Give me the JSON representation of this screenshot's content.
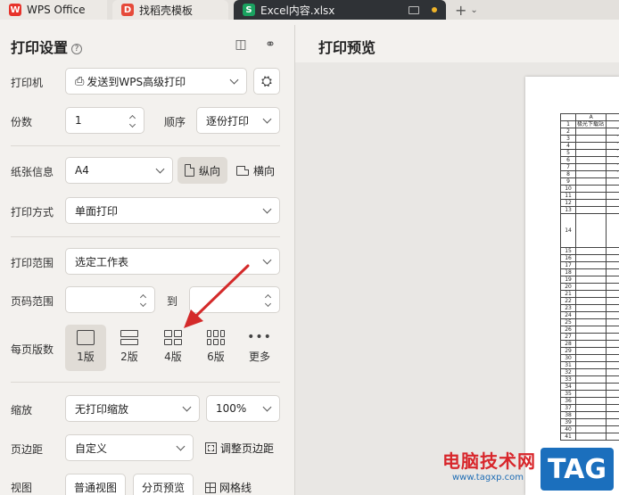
{
  "tabs": [
    {
      "label": "WPS Office",
      "icon": "wps-logo-icon"
    },
    {
      "label": "找稻壳模板",
      "icon": "daoke-logo-icon"
    },
    {
      "label": "Excel内容.xlsx",
      "icon": "excel-file-icon",
      "active": true
    }
  ],
  "panel": {
    "title": "打印设置",
    "printer": {
      "label": "打印机",
      "value": "发送到WPS高级打印"
    },
    "copies": {
      "label": "份数",
      "value": "1"
    },
    "order": {
      "label": "顺序",
      "value": "逐份打印"
    },
    "paper": {
      "label": "纸张信息",
      "size": "A4",
      "portrait": "纵向",
      "landscape": "横向"
    },
    "print_mode": {
      "label": "打印方式",
      "value": "单面打印"
    },
    "range": {
      "label": "打印范围",
      "value": "选定工作表"
    },
    "page_range": {
      "label": "页码范围",
      "to": "到"
    },
    "pages_per_sheet": {
      "label": "每页版数",
      "options": [
        "1版",
        "2版",
        "4版",
        "6版",
        "更多"
      ],
      "selected": "1版"
    },
    "scale": {
      "label": "缩放",
      "value": "无打印缩放",
      "percent": "100%"
    },
    "margin": {
      "label": "页边距",
      "value": "自定义",
      "adjust": "调整页边距"
    },
    "view": {
      "label": "视图",
      "normal": "普通视图",
      "page_break": "分页预览",
      "gridlines": "网格线"
    }
  },
  "preview": {
    "title": "打印预览",
    "sheet": {
      "col_header": "A",
      "first_cell": "极光下载站",
      "row_numbers": [
        "1",
        "2",
        "3",
        "4",
        "5",
        "6",
        "7",
        "8",
        "9",
        "10",
        "11",
        "12",
        "13",
        "14",
        "15",
        "16",
        "17",
        "18",
        "19",
        "20",
        "21",
        "22",
        "23",
        "24",
        "25",
        "26",
        "27",
        "28",
        "29",
        "30",
        "31",
        "32",
        "33",
        "34",
        "35",
        "36",
        "37",
        "38",
        "39",
        "40",
        "41"
      ]
    }
  },
  "watermark": {
    "site": "电脑技术网",
    "url": "www.tagxp.com",
    "tag": "TAG"
  },
  "colors": {
    "accent_arrow": "#d42a2a",
    "excel_tab_bg": "#2f3236"
  }
}
